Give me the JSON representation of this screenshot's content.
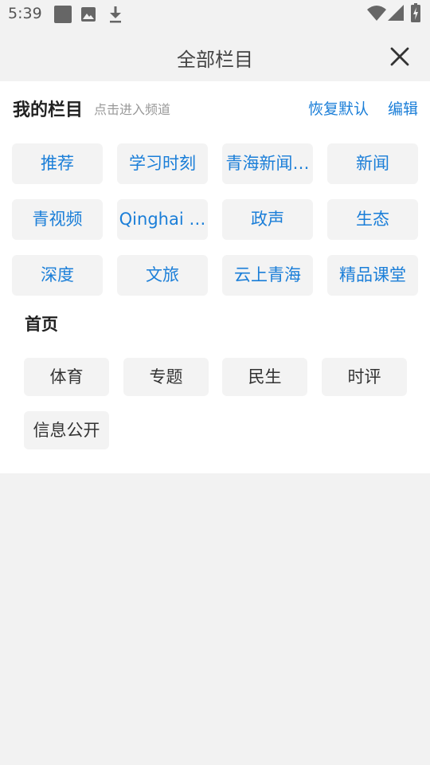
{
  "status_bar": {
    "time": "5:39",
    "icons": [
      "notification-square-icon",
      "image-icon",
      "download-icon",
      "wifi-icon",
      "signal-icon",
      "battery-charging-icon"
    ]
  },
  "header": {
    "title": "全部栏目",
    "close_icon": "close-icon"
  },
  "my_channels": {
    "title": "我的栏目",
    "hint": "点击进入频道",
    "reset_label": "恢复默认",
    "edit_label": "编辑",
    "items": [
      "推荐",
      "学习时刻",
      "青海新闻…",
      "新闻",
      "青视频",
      "Qinghai …",
      "政声",
      "生态",
      "深度",
      "文旅",
      "云上青海",
      "精品课堂"
    ]
  },
  "other_section": {
    "title": "首页",
    "items": [
      "体育",
      "专题",
      "民生",
      "时评",
      "信息公开"
    ]
  },
  "colors": {
    "accent": "#1a7ed8",
    "background": "#f2f2f2",
    "panel": "#ffffff",
    "chip": "#f3f3f3"
  }
}
